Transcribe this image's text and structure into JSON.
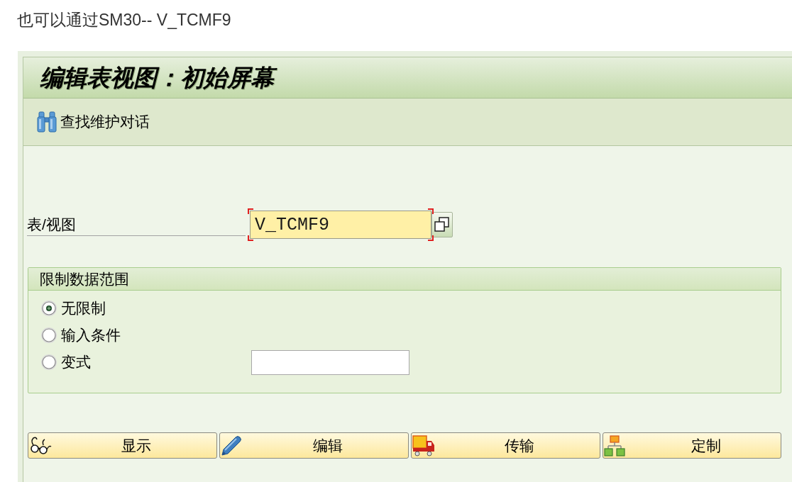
{
  "intro_text": "也可以通过SM30-- V_TCMF9",
  "window": {
    "title": "编辑表视图：初始屏幕"
  },
  "toolbar": {
    "items": [
      {
        "label": "查找维护对话"
      }
    ]
  },
  "table_view": {
    "label": "表/视图",
    "value": "V_TCMF9",
    "focused": true
  },
  "restriction": {
    "title": "限制数据范围",
    "options": [
      {
        "label": "无限制",
        "selected": true,
        "kind": "plain"
      },
      {
        "label": "输入条件",
        "selected": false,
        "kind": "plain"
      },
      {
        "label": "变式",
        "selected": false,
        "kind": "with_field"
      }
    ]
  },
  "actions": [
    {
      "label": "显示"
    },
    {
      "label": "编辑"
    },
    {
      "label": "传输"
    },
    {
      "label": "定制"
    }
  ]
}
